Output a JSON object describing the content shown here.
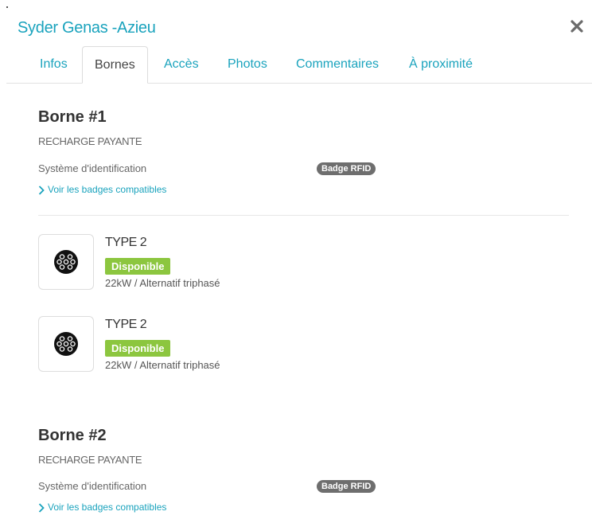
{
  "header": {
    "title": "Syder Genas -Azieu"
  },
  "tabs": [
    {
      "label": "Infos",
      "active": false
    },
    {
      "label": "Bornes",
      "active": true
    },
    {
      "label": "Accès",
      "active": false
    },
    {
      "label": "Photos",
      "active": false
    },
    {
      "label": "Commentaires",
      "active": false
    },
    {
      "label": "À proximité",
      "active": false
    }
  ],
  "bornes": [
    {
      "title": "Borne #1",
      "subtitle": "RECHARGE PAYANTE",
      "ident_label": "Système d'identification",
      "ident_badge": "Badge RFID",
      "link": "Voir les badges compatibles",
      "connectors": [
        {
          "type": "TYPE 2",
          "status": "Disponible",
          "power": "22kW  / Alternatif triphasé",
          "icon": "type2-connector-icon"
        },
        {
          "type": "TYPE 2",
          "status": "Disponible",
          "power": "22kW  / Alternatif triphasé",
          "icon": "type2-connector-icon"
        }
      ]
    },
    {
      "title": "Borne #2",
      "subtitle": "RECHARGE PAYANTE",
      "ident_label": "Système d'identification",
      "ident_badge": "Badge RFID",
      "link": "Voir les badges compatibles"
    }
  ],
  "colors": {
    "accent": "#1aa3bd",
    "available": "#8cc63f",
    "badge": "#6e6e6e"
  }
}
